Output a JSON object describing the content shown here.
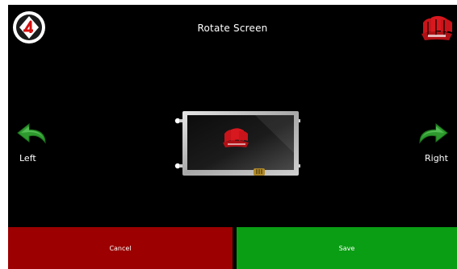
{
  "screen": {
    "title": "Rotate Screen"
  },
  "logos": {
    "left_icon": "4d-logo-icon",
    "right_icon": "sail-boat-logo-icon",
    "boat_color": "#c8141a"
  },
  "controls": {
    "left_label": "Left",
    "right_label": "Right",
    "arrow_color": "#2e9a2e",
    "left_icon": "curved-arrow-left-icon",
    "right_icon": "curved-arrow-right-icon"
  },
  "preview": {
    "icon": "display-module-icon"
  },
  "buttons": {
    "cancel_label": "Cancel",
    "save_label": "Save",
    "cancel_color": "#9c0000",
    "save_color": "#0a9e14"
  }
}
